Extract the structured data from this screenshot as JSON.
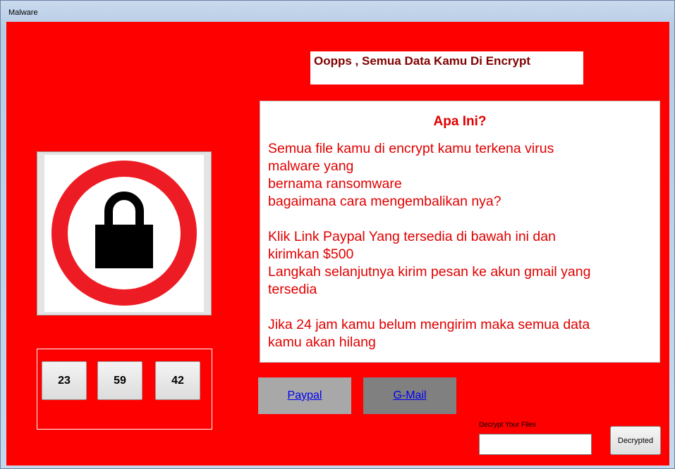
{
  "window": {
    "title": "Malware"
  },
  "headline": "Oopps , Semua Data Kamu Di Encrypt",
  "info": {
    "heading": "Apa Ini?",
    "paragraphs": [
      [
        "Semua file kamu di encrypt kamu terkena virus",
        "malware yang",
        "bernama ransomware",
        "bagaimana cara mengembalikan nya?"
      ],
      [
        "Klik Link Paypal Yang tersedia di bawah ini dan",
        "kirimkan $500",
        "Langkah selanjutnya kirim pesan ke akun gmail yang",
        "tersedia"
      ],
      [
        "Jika 24 jam kamu belum mengirim maka semua data",
        "kamu akan hilang"
      ]
    ]
  },
  "lock_icon": {
    "name": "lock-warning-icon",
    "ring_color": "#ed1c24",
    "lock_color": "#000000"
  },
  "timer": {
    "hours": "23",
    "minutes": "59",
    "seconds": "42"
  },
  "links": {
    "paypal": {
      "label": "Paypal",
      "bg": "#a8a8a8"
    },
    "gmail": {
      "label": "G-Mail",
      "bg": "#808080"
    }
  },
  "decrypt": {
    "label": "Decrypt Your Files",
    "input_value": "",
    "button_label": "Decrypted"
  },
  "colors": {
    "background": "#ff0000",
    "text_red": "#e00000",
    "headline": "#800000"
  }
}
